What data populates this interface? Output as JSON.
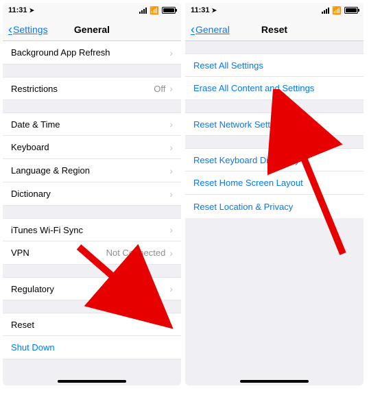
{
  "status": {
    "time": "11:31"
  },
  "left": {
    "back_label": "Settings",
    "title": "General",
    "rows": {
      "bg_refresh": "Background App Refresh",
      "restrictions": "Restrictions",
      "restrictions_val": "Off",
      "date_time": "Date & Time",
      "keyboard": "Keyboard",
      "lang_region": "Language & Region",
      "dictionary": "Dictionary",
      "itunes_sync": "iTunes Wi-Fi Sync",
      "vpn": "VPN",
      "vpn_val": "Not Connected",
      "regulatory": "Regulatory",
      "reset": "Reset",
      "shutdown": "Shut Down"
    }
  },
  "right": {
    "back_label": "General",
    "title": "Reset",
    "rows": {
      "reset_all": "Reset All Settings",
      "erase_all": "Erase All Content and Settings",
      "reset_network": "Reset Network Settings",
      "reset_keyboard": "Reset Keyboard Dictionary",
      "reset_home": "Reset Home Screen Layout",
      "reset_loc": "Reset Location & Privacy"
    }
  }
}
